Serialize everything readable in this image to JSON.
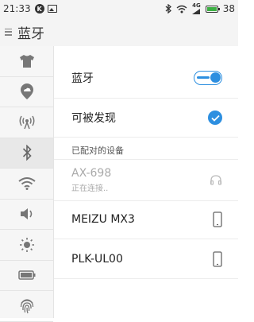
{
  "status_bar": {
    "time": "21:33",
    "k_badge": "K",
    "network": "4G",
    "battery": "38"
  },
  "header": {
    "title": "蓝牙",
    "menu_icon": "hamburger-icon"
  },
  "sidebar": {
    "items": [
      {
        "icon": "shirt-icon",
        "active": false
      },
      {
        "icon": "cloud-location-icon",
        "active": false
      },
      {
        "icon": "hotspot-icon",
        "active": false
      },
      {
        "icon": "bluetooth-icon",
        "active": true
      },
      {
        "icon": "wifi-icon",
        "active": false
      },
      {
        "icon": "volume-icon",
        "active": false
      },
      {
        "icon": "brightness-icon",
        "active": false
      },
      {
        "icon": "battery-icon",
        "active": false
      },
      {
        "icon": "fingerprint-icon",
        "active": false
      }
    ]
  },
  "settings": {
    "bluetooth_label": "蓝牙",
    "bluetooth_on": true,
    "discoverable_label": "可被发现",
    "discoverable_checked": true
  },
  "paired_section": {
    "header": "已配对的设备",
    "devices": [
      {
        "name": "AX-698",
        "status": "正在连接..",
        "icon": "headphones-icon",
        "dimmed": true
      },
      {
        "name": "MEIZU MX3",
        "status": "",
        "icon": "phone-icon",
        "dimmed": false
      },
      {
        "name": "PLK-UL00",
        "status": "",
        "icon": "phone-icon",
        "dimmed": false
      }
    ]
  },
  "colors": {
    "accent": "#2d8fe0",
    "background": "#ffffff",
    "sidebar_bg": "#f6f6f6"
  }
}
